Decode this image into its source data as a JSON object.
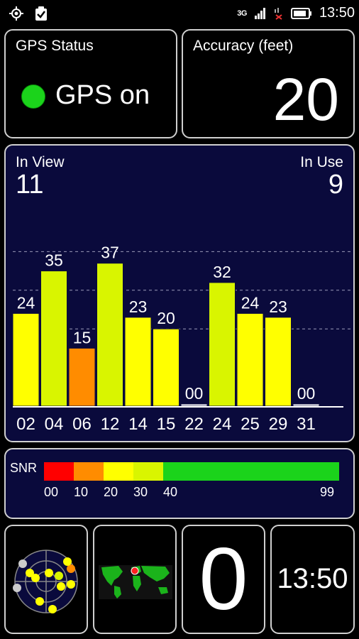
{
  "status_bar": {
    "icons": [
      "location-icon",
      "task-check-icon"
    ],
    "network": "3G",
    "time": "13:50"
  },
  "gps_status": {
    "title": "GPS Status",
    "state_text": "GPS on",
    "state_color": "#1bd31b"
  },
  "accuracy": {
    "title": "Accuracy (feet)",
    "value": "20"
  },
  "satellites": {
    "in_view_label": "In View",
    "in_view_value": "11",
    "in_use_label": "In Use",
    "in_use_value": "9"
  },
  "chart_data": {
    "type": "bar",
    "categories": [
      "02",
      "04",
      "06",
      "12",
      "14",
      "15",
      "22",
      "24",
      "25",
      "29",
      "31"
    ],
    "values": [
      24,
      35,
      15,
      37,
      23,
      20,
      0,
      32,
      24,
      23,
      0
    ],
    "value_labels": [
      "24",
      "35",
      "15",
      "37",
      "23",
      "20",
      "00",
      "32",
      "24",
      "23",
      "00"
    ],
    "bar_colors": [
      "#ffff00",
      "#d9f500",
      "#ff8c00",
      "#d9f500",
      "#ffff00",
      "#ffff00",
      "#ffffff",
      "#d9f500",
      "#ffff00",
      "#ffff00",
      "#ffffff"
    ],
    "ylim": [
      0,
      50
    ],
    "grid": true
  },
  "snr": {
    "label": "SNR",
    "segments": [
      {
        "from": 0,
        "to": 10,
        "color": "#ff0000"
      },
      {
        "from": 10,
        "to": 20,
        "color": "#ff8c00"
      },
      {
        "from": 20,
        "to": 30,
        "color": "#ffff00"
      },
      {
        "from": 30,
        "to": 40,
        "color": "#d9f500"
      },
      {
        "from": 40,
        "to": 99,
        "color": "#1bd31b"
      }
    ],
    "ticks": [
      "00",
      "10",
      "20",
      "30",
      "40",
      "99"
    ]
  },
  "bottom": {
    "radar_icon": "sky-radar-icon",
    "map_icon": "world-map-icon",
    "count": "0",
    "time": "13:50"
  }
}
